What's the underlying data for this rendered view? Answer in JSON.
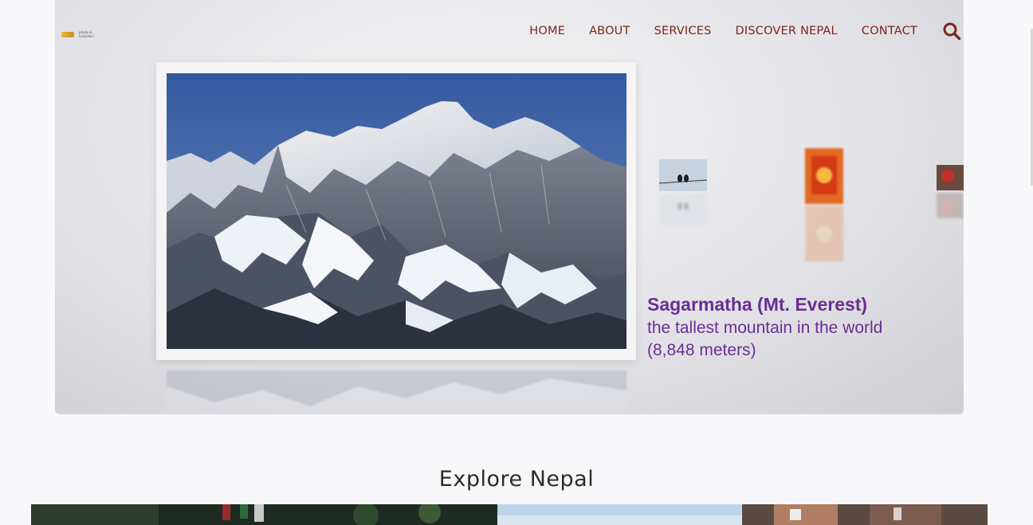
{
  "brand": {
    "logo_line1": "phyllo &",
    "logo_line2": "travellers"
  },
  "nav": {
    "items": [
      "HOME",
      "ABOUT",
      "SERVICES",
      "DISCOVER NEPAL",
      "CONTACT"
    ],
    "search_icon": "search-icon"
  },
  "hero": {
    "caption_title": "Sagarmatha (Mt. Everest)",
    "caption_subtitle": "the tallest mountain in the world (8,848 meters)"
  },
  "explore": {
    "title": "Explore Nepal"
  },
  "colors": {
    "nav_text": "#7a2619",
    "caption": "#6a2e95",
    "page_bg": "#f8f7fa"
  }
}
